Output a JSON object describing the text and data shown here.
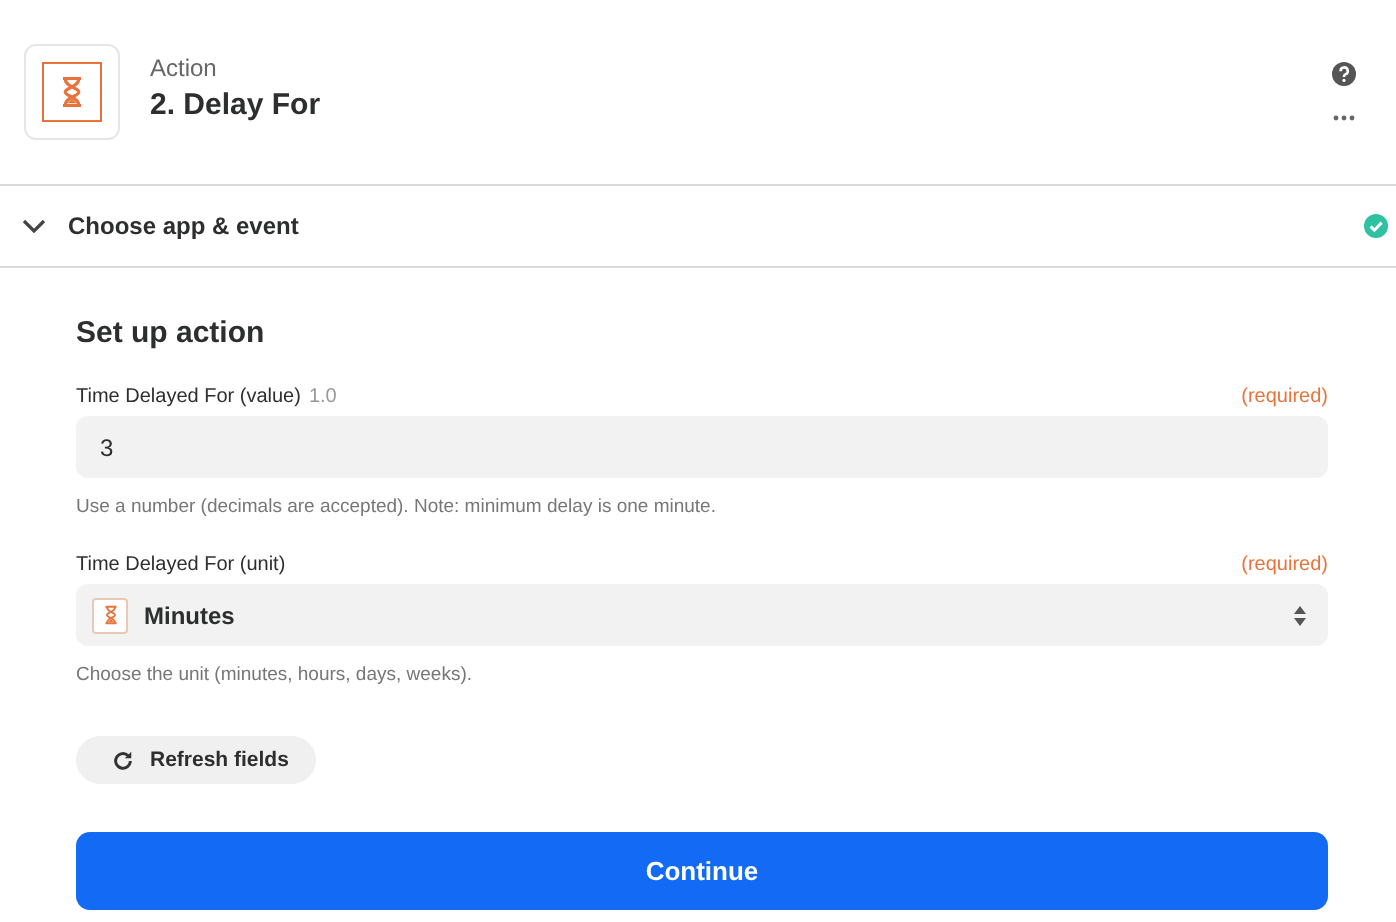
{
  "header": {
    "label": "Action",
    "title": "2. Delay For"
  },
  "section": {
    "title": "Choose app & event",
    "expanded": true,
    "completed": true
  },
  "form": {
    "title": "Set up action",
    "fields": [
      {
        "kind": "text",
        "label": "Time Delayed For (value)",
        "version": "1.0",
        "required": "(required)",
        "value": "3",
        "hint": "Use a number (decimals are accepted). Note: minimum delay is one minute."
      },
      {
        "kind": "select",
        "label": "Time Delayed For (unit)",
        "required": "(required)",
        "value": "Minutes",
        "hint": "Choose the unit (minutes, hours, days, weeks)."
      }
    ],
    "refresh": "Refresh fields",
    "continue": "Continue"
  }
}
